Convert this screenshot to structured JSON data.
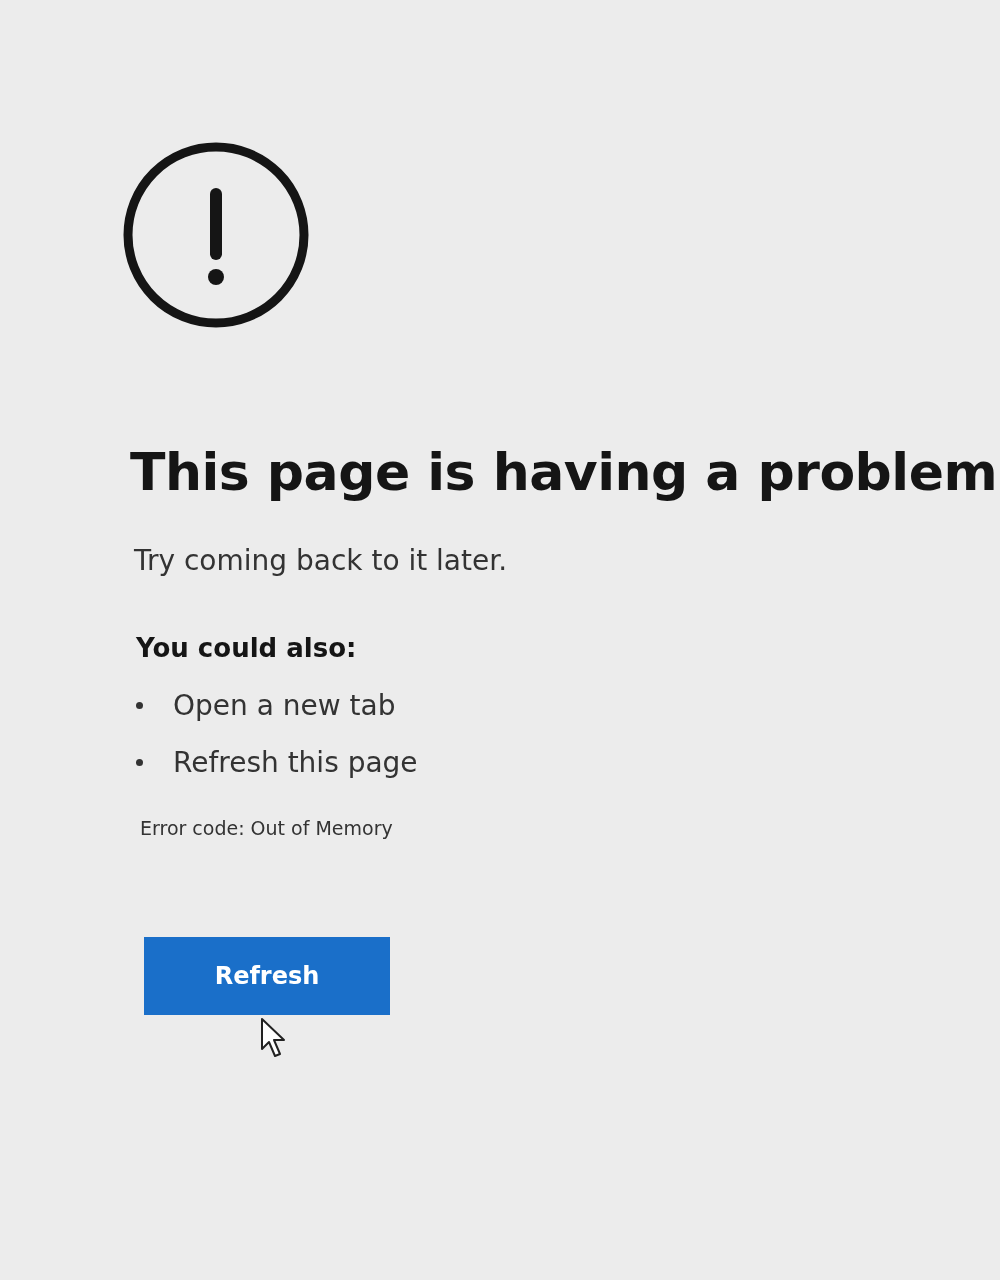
{
  "heading": "This page is having a problem",
  "message": "Try coming back to it later.",
  "suggestions_title": "You could also:",
  "suggestions": [
    "Open a new tab",
    "Refresh this page"
  ],
  "error_code": "Error code: Out of Memory",
  "button": {
    "label": "Refresh"
  }
}
